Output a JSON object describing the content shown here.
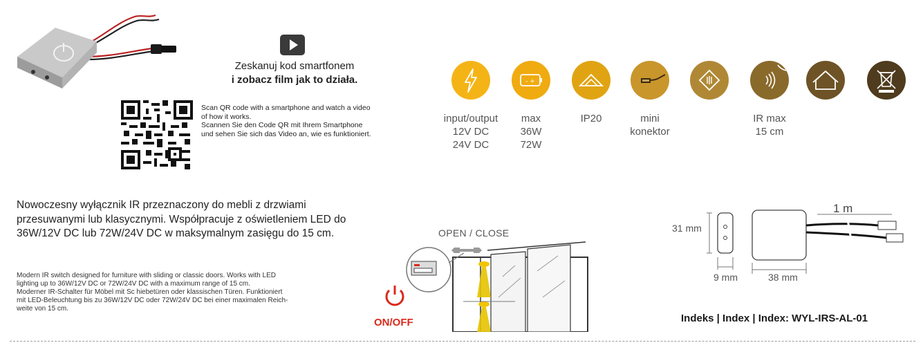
{
  "product": {
    "name": "product-photo"
  },
  "video": {
    "play_icon": "play-icon",
    "scan_pl_line1": "Zeskanuj kod smartfonem",
    "scan_pl_line2": "i zobacz film jak to działa.",
    "scan_other_lines": [
      "Scan QR code with a smartphone and watch a video",
      "of how it works.",
      "Scannen Sie den Code QR mit Ihrem Smartphone",
      "und sehen Sie sich das Video an, wie es funktioniert."
    ]
  },
  "features": [
    {
      "icon": "lightning-icon",
      "color": "#f5b416",
      "label": "input/output\n12V DC\n24V DC"
    },
    {
      "icon": "battery-icon",
      "color": "#f0ab10",
      "label": "max\n36W\n72W"
    },
    {
      "icon": "ip20-icon",
      "color": "#e0a413",
      "label": "IP20"
    },
    {
      "icon": "mini-connector-icon",
      "color": "#c9962c",
      "label": "mini\nkonektor"
    },
    {
      "icon": "sliding-door-icon",
      "color": "#b08835",
      "label": ""
    },
    {
      "icon": "ir-hand-icon",
      "color": "#8a6a2b",
      "label": "IR max\n15 cm"
    },
    {
      "icon": "house-icon",
      "color": "#6e5326",
      "label": ""
    },
    {
      "icon": "no-bin-icon",
      "color": "#4f3b1d",
      "label": ""
    }
  ],
  "description": {
    "pl": "Nowoczesny wyłącznik IR przeznaczony do mebli z drzwiami przesuwanymi lub klasycznymi. Współpracuje z oświetleniem LED do 36W/12V DC lub 72W/24V DC w maksymalnym zasięgu do 15 cm.",
    "other_lines": [
      "Modern IR switch designed for furniture with sliding or classic doors. Works with LED",
      "lighting up to 36W/12V DC or 72W/24V DC with a maximum range of 15 cm.",
      "Moderner IR-Schalter für Möbel mit Sc hiebetüren oder klassischen Türen. Funktioniert",
      "mit LED-Beleuchtung bis zu 36W/12V DC oder 72W/24V DC bei einer maximalen Reich-",
      "weite von 15 cm."
    ]
  },
  "illustration": {
    "open_close": "OPEN / CLOSE",
    "on_off": "ON/OFF"
  },
  "dimensions": {
    "height": "31 mm",
    "cable": "1 m",
    "depth": "9 mm",
    "width": "38 mm"
  },
  "index_label": "Indeks | Index | Index: WYL-IRS-AL-01"
}
